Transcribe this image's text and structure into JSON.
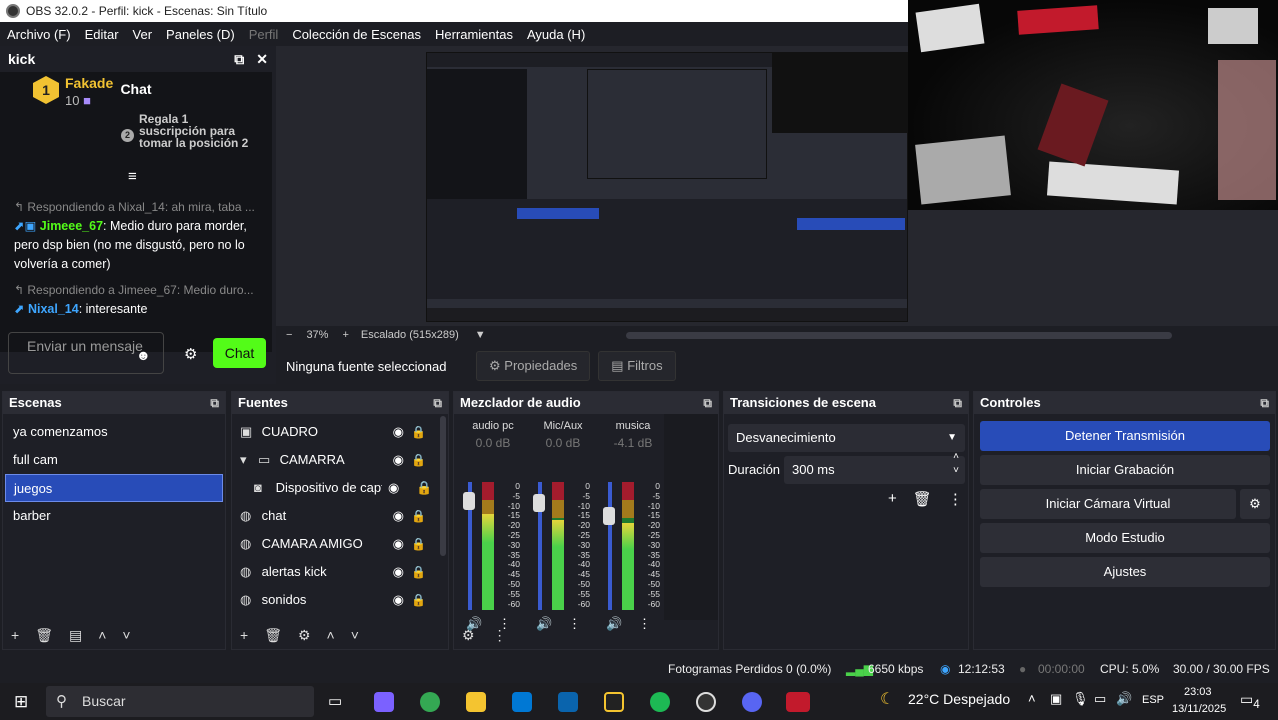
{
  "window": {
    "title": "OBS 32.0.2 - Perfil: kick - Escenas: Sin Título"
  },
  "menu": [
    "Archivo (F)",
    "Editar",
    "Ver",
    "Paneles (D)",
    "Perfil",
    "Colección de Escenas",
    "Herramientas",
    "Ayuda (H)"
  ],
  "kick_dock": {
    "title": "kick",
    "chat_title": "Chat",
    "pinned": {
      "rank": "1",
      "user": "Fakade",
      "count": "10",
      "gift_badge": "2",
      "gift_text": "Regala 1 suscripción para tomar la posición 2"
    },
    "messages": [
      {
        "reply": "Respondiendo a Nixal_14: ah mira, taba ...",
        "user": "Jimeee_67",
        "text": ": Medio duro para morder, pero dsp bien (no me disgustó, pero no lo volvería a comer)"
      },
      {
        "reply": "Respondiendo a Jimeee_67: Medio duro...",
        "user": "Nixal_14",
        "text": ": interesante"
      }
    ],
    "input_placeholder": "Enviar un mensaje",
    "send_label": "Chat"
  },
  "preview": {
    "zoom": "37%",
    "scale_label": "Escalado (515x289)"
  },
  "source_bar": {
    "none_selected": "Ninguna fuente seleccionada",
    "properties": "Propiedades",
    "filters": "Filtros"
  },
  "scenes": {
    "title": "Escenas",
    "items": [
      "ya comenzamos",
      "full cam",
      "juegos",
      "barber"
    ],
    "selected": "juegos"
  },
  "sources": {
    "title": "Fuentes",
    "items": [
      "CUADRO",
      "CAMARRA",
      "Dispositivo de captura",
      "chat",
      "CAMARA AMIGO",
      "alertas kick",
      "sonidos"
    ]
  },
  "mixer": {
    "title": "Mezclador de audio",
    "channels": [
      {
        "name": "audio pc",
        "db": "0.0 dB",
        "level": 0.75
      },
      {
        "name": "Mic/Aux",
        "db": "0.0 dB",
        "level": 0.7
      },
      {
        "name": "musica",
        "db": "-4.1 dB",
        "level": 0.68
      }
    ],
    "scale": [
      "0",
      "-5",
      "-10",
      "-15",
      "-20",
      "-25",
      "-30",
      "-35",
      "-40",
      "-45",
      "-50",
      "-55",
      "-60"
    ]
  },
  "transitions": {
    "title": "Transiciones de escena",
    "selected": "Desvanecimiento",
    "duration_label": "Duración",
    "duration": "300 ms"
  },
  "controls": {
    "title": "Controles",
    "buttons": [
      "Detener Transmisión",
      "Iniciar Grabación",
      "Iniciar Cámara Virtual",
      "Modo Estudio",
      "Ajustes"
    ]
  },
  "status": {
    "dropped": "Fotogramas Perdidos 0 (0.0%)",
    "bitrate": "6650 kbps",
    "stream_time": "12:12:53",
    "rec_time": "00:00:00",
    "cpu": "CPU: 5.0%",
    "fps": "30.00 / 30.00 FPS"
  },
  "taskbar": {
    "search": "Buscar",
    "weather": "22°C Despejado",
    "lang": "ESP",
    "time": "23:03",
    "date": "13/11/2025",
    "notif": "4"
  },
  "colors": {
    "accent": "#284cb8",
    "kick_green": "#53fc18",
    "gold": "#f1c232"
  }
}
